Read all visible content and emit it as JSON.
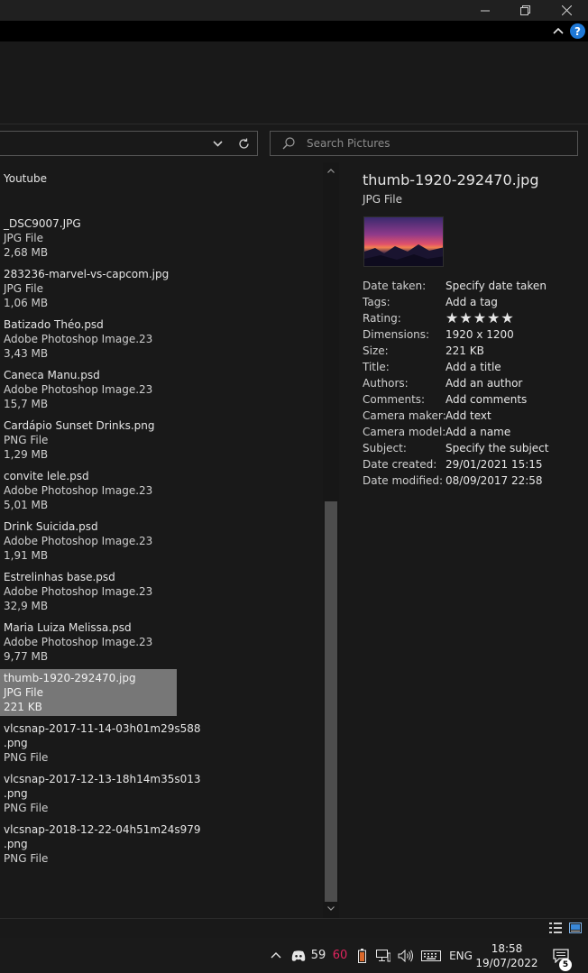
{
  "search": {
    "placeholder": "Search Pictures"
  },
  "file_list": {
    "group_header": "Youtube",
    "items": [
      {
        "name": "_DSC9007.JPG",
        "type": "JPG File",
        "size": "2,68 MB"
      },
      {
        "name": "283236-marvel-vs-capcom.jpg",
        "type": "JPG File",
        "size": "1,06 MB"
      },
      {
        "name": "Batizado Théo.psd",
        "type": "Adobe Photoshop Image.23",
        "size": "3,43 MB"
      },
      {
        "name": "Caneca Manu.psd",
        "type": "Adobe Photoshop Image.23",
        "size": "15,7 MB"
      },
      {
        "name": "Cardápio Sunset Drinks.png",
        "type": "PNG File",
        "size": "1,29 MB"
      },
      {
        "name": "convite lele.psd",
        "type": "Adobe Photoshop Image.23",
        "size": "5,01 MB"
      },
      {
        "name": "Drink Suicida.psd",
        "type": "Adobe Photoshop Image.23",
        "size": "1,91 MB"
      },
      {
        "name": "Estrelinhas base.psd",
        "type": "Adobe Photoshop Image.23",
        "size": "32,9 MB"
      },
      {
        "name": "Maria Luiza Melissa.psd",
        "type": "Adobe Photoshop Image.23",
        "size": "9,77 MB"
      },
      {
        "name": "thumb-1920-292470.jpg",
        "type": "JPG File",
        "size": "221 KB",
        "selected": true
      },
      {
        "name": "vlcsnap-2017-11-14-03h01m29s588",
        "name2": ".png",
        "type": "PNG File"
      },
      {
        "name": "vlcsnap-2017-12-13-18h14m35s013",
        "name2": ".png",
        "type": "PNG File"
      },
      {
        "name": "vlcsnap-2018-12-22-04h51m24s979",
        "name2": ".png",
        "type": "PNG File"
      }
    ]
  },
  "details": {
    "title": "thumb-1920-292470.jpg",
    "type": "JPG File",
    "rating_stars": 0,
    "properties": [
      {
        "label": "Date taken:",
        "value": "Specify date taken"
      },
      {
        "label": "Tags:",
        "value": "Add a tag"
      },
      {
        "label": "Rating:",
        "value": ""
      },
      {
        "label": "Dimensions:",
        "value": "1920 x 1200"
      },
      {
        "label": "Size:",
        "value": "221 KB"
      },
      {
        "label": "Title:",
        "value": "Add a title"
      },
      {
        "label": "Authors:",
        "value": "Add an author"
      },
      {
        "label": "Comments:",
        "value": "Add comments"
      },
      {
        "label": "Camera maker:",
        "value": "Add text"
      },
      {
        "label": "Camera model:",
        "value": "Add a name"
      },
      {
        "label": "Subject:",
        "value": "Specify the subject"
      },
      {
        "label": "Date created:",
        "value": "29/01/2021 15:15"
      },
      {
        "label": "Date modified:",
        "value": "08/09/2017 22:58"
      }
    ]
  },
  "taskbar": {
    "tray_num_1": "59",
    "tray_num_2": "60",
    "tray_num_2_color": "#e0245e",
    "language": "ENG",
    "time": "18:58",
    "date": "19/07/2022",
    "notification_count": "5"
  },
  "colors": {
    "selection": "#777777",
    "background": "#191919",
    "accent_help": "#1e78d6"
  }
}
